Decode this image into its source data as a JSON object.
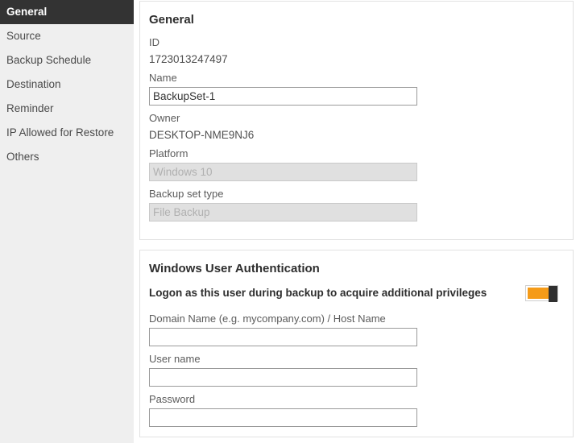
{
  "sidebar": {
    "items": [
      {
        "label": "General",
        "active": true
      },
      {
        "label": "Source",
        "active": false
      },
      {
        "label": "Backup Schedule",
        "active": false
      },
      {
        "label": "Destination",
        "active": false
      },
      {
        "label": "Reminder",
        "active": false
      },
      {
        "label": "IP Allowed for Restore",
        "active": false
      },
      {
        "label": "Others",
        "active": false
      }
    ]
  },
  "general": {
    "title": "General",
    "id_label": "ID",
    "id_value": "1723013247497",
    "name_label": "Name",
    "name_value": "BackupSet-1",
    "owner_label": "Owner",
    "owner_value": "DESKTOP-NME9NJ6",
    "platform_label": "Platform",
    "platform_value": "Windows 10",
    "backup_set_type_label": "Backup set type",
    "backup_set_type_value": "File Backup"
  },
  "auth": {
    "title": "Windows User Authentication",
    "logon_toggle_label": "Logon as this user during backup to acquire additional privileges",
    "logon_toggle_state": "on",
    "domain_label": "Domain Name (e.g. mycompany.com) / Host Name",
    "domain_value": "",
    "username_label": "User name",
    "username_value": "",
    "password_label": "Password",
    "password_value": ""
  },
  "colors": {
    "accent": "#f59b18",
    "sidebar_active_bg": "#333333",
    "sidebar_bg": "#efefef",
    "panel_border": "#e2e2e2",
    "disabled_bg": "#e0e0e0"
  }
}
